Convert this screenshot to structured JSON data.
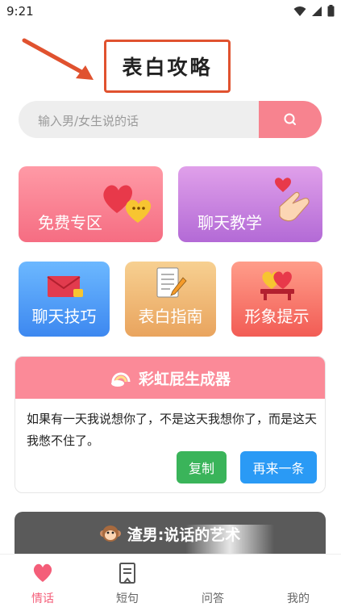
{
  "status_bar": {
    "time": "9:21"
  },
  "title": "表白攻略",
  "search": {
    "placeholder": "输入男/女生说的话"
  },
  "cards": {
    "free": "免费专区",
    "chat_teaching": "聊天教学",
    "chat_skills": "聊天技巧",
    "confession_guide": "表白指南",
    "image_tips": "形象提示"
  },
  "generator": {
    "title": "彩虹屁生成器",
    "text": "如果有一天我说想你了，不是这天我想你了，而是这天我憋不住了。",
    "copy_label": "复制",
    "again_label": "再来一条"
  },
  "scum_section": {
    "title": "渣男:说话的艺术"
  },
  "tabs": [
    {
      "label": "情话",
      "icon": "heart-icon",
      "active": true
    },
    {
      "label": "短句",
      "icon": "document-icon",
      "active": false
    },
    {
      "label": "问答",
      "icon": "question-icon",
      "active": false
    },
    {
      "label": "我的",
      "icon": "user-icon",
      "active": false
    }
  ],
  "colors": {
    "accent": "#f45e79",
    "search_button": "#f7838f",
    "copy_button": "#3ab45a",
    "again_button": "#2a9af5",
    "title_border": "#e0522f"
  }
}
